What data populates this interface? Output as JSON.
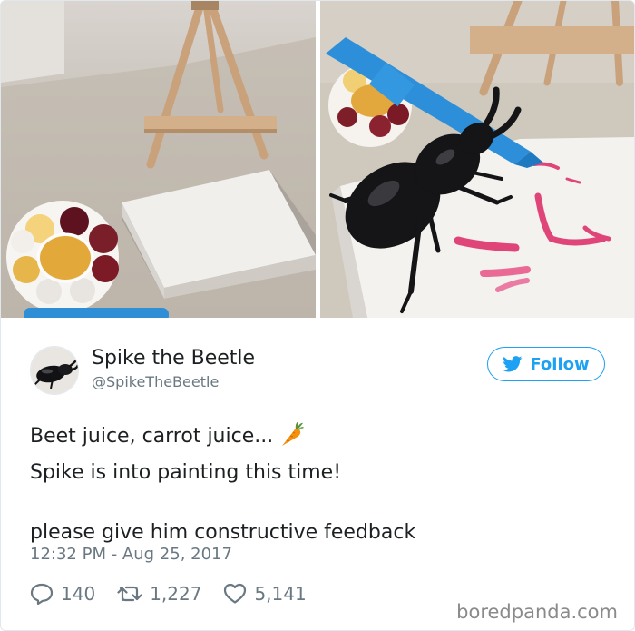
{
  "tweet": {
    "display_name": "Spike the Beetle",
    "handle": "@SpikeTheBeetle",
    "follow_label": "Follow",
    "text_line1": "Beet juice, carrot juice...",
    "text_line2": "Spike is into painting this time!",
    "text_line3": "please give him constructive feedback",
    "emoji": "carrot-icon",
    "timestamp": "12:32 PM - Aug 25, 2017",
    "replies": "140",
    "retweets": "1,227",
    "likes": "5,141"
  },
  "watermark": "boredpanda.com",
  "colors": {
    "twitter_blue": "#1da1f2",
    "muted_text": "#697882",
    "text": "#1c2022"
  }
}
